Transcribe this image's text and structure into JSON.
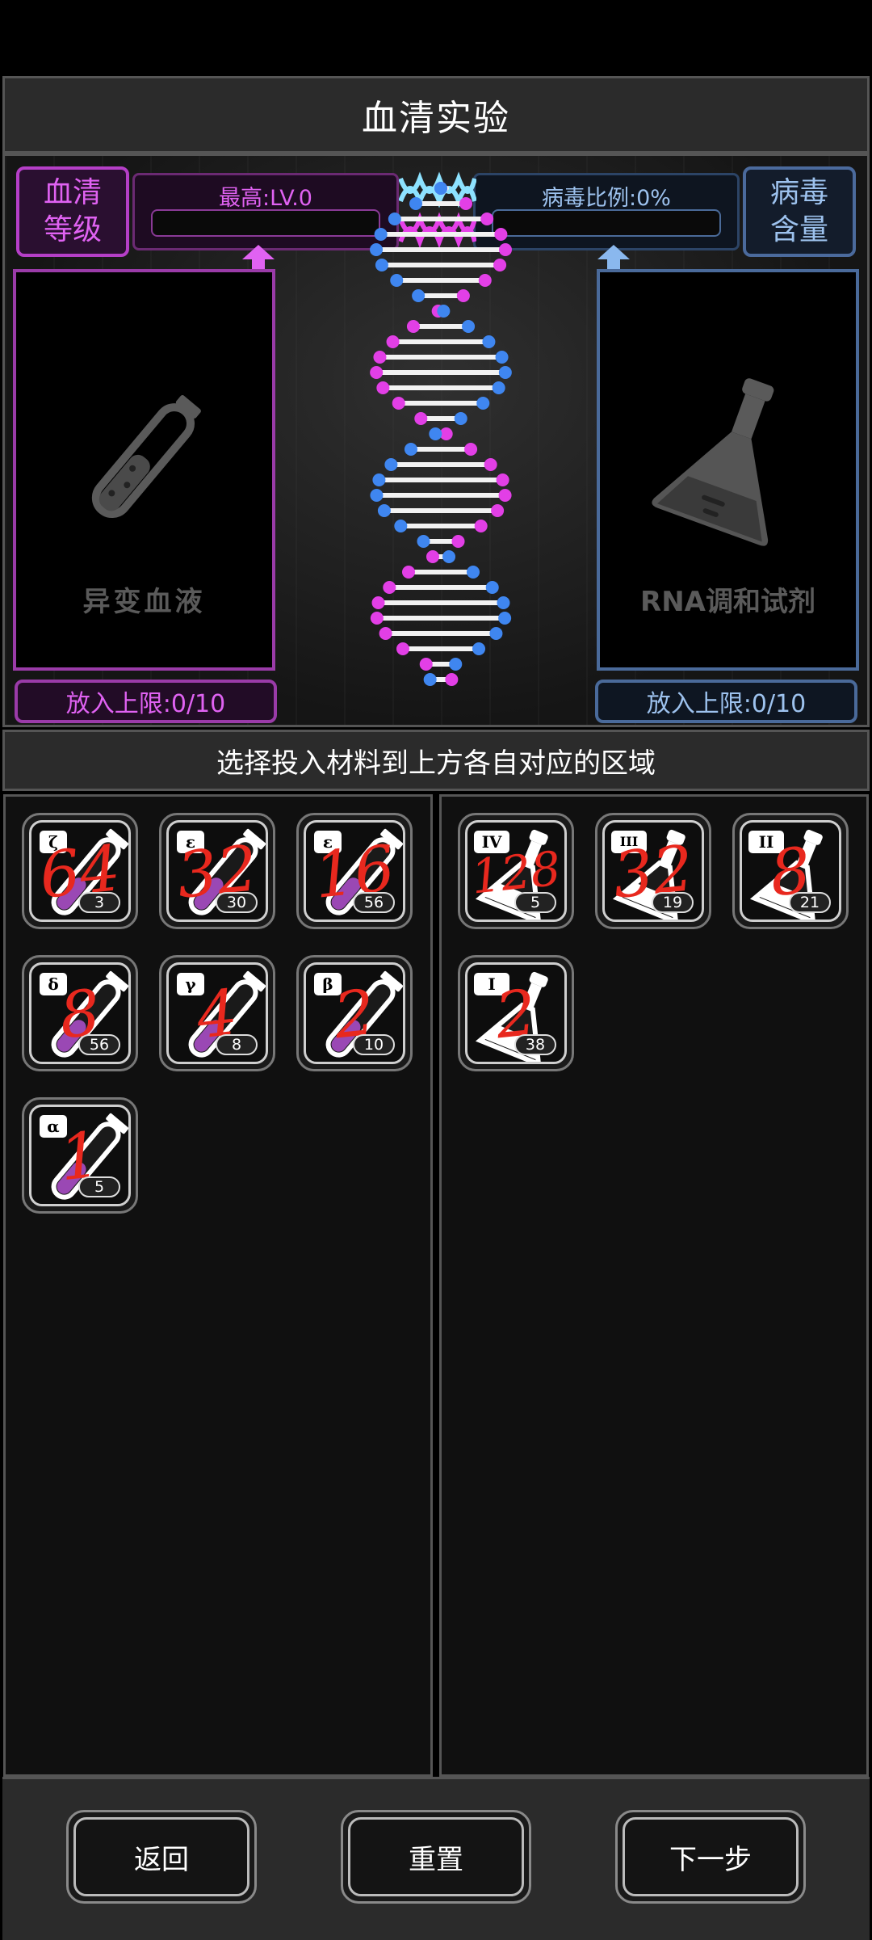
{
  "header": {
    "title": "血清实验"
  },
  "lab": {
    "left_chip": "血清\n等级",
    "right_chip": "病毒\n含量",
    "left_meter_label": "最高:LV.0",
    "right_meter_label": "病毒比例:0%",
    "left_slot_label": "异变血液",
    "right_slot_label": "RNA调和试剂",
    "left_limit": "放入上限:0/10",
    "right_limit": "放入上限:0/10",
    "left_meter_progress": 0,
    "right_meter_progress": 0
  },
  "instruction": "选择投入材料到上方各自对应的区域",
  "blood_items": [
    {
      "tag": "ζ",
      "count": "3",
      "handwritten": "64"
    },
    {
      "tag": "ε",
      "count": "30",
      "handwritten": "32"
    },
    {
      "tag": "ε",
      "count": "56",
      "handwritten": "16"
    },
    {
      "tag": "δ",
      "count": "56",
      "handwritten": "8"
    },
    {
      "tag": "γ",
      "count": "8",
      "handwritten": "4"
    },
    {
      "tag": "β",
      "count": "10",
      "handwritten": "2"
    },
    {
      "tag": "α",
      "count": "5",
      "handwritten": "1"
    }
  ],
  "reagent_items": [
    {
      "tag": "IV",
      "count": "5",
      "handwritten": "128"
    },
    {
      "tag": "III",
      "count": "19",
      "handwritten": "32"
    },
    {
      "tag": "II",
      "count": "21",
      "handwritten": "8"
    },
    {
      "tag": "I",
      "count": "38",
      "handwritten": "2"
    }
  ],
  "buttons": {
    "back": "返回",
    "reset": "重置",
    "next": "下一步"
  },
  "colors": {
    "magenta": "#e062f2",
    "blue": "#9dc2ee",
    "annotation_red": "#e8281e"
  }
}
